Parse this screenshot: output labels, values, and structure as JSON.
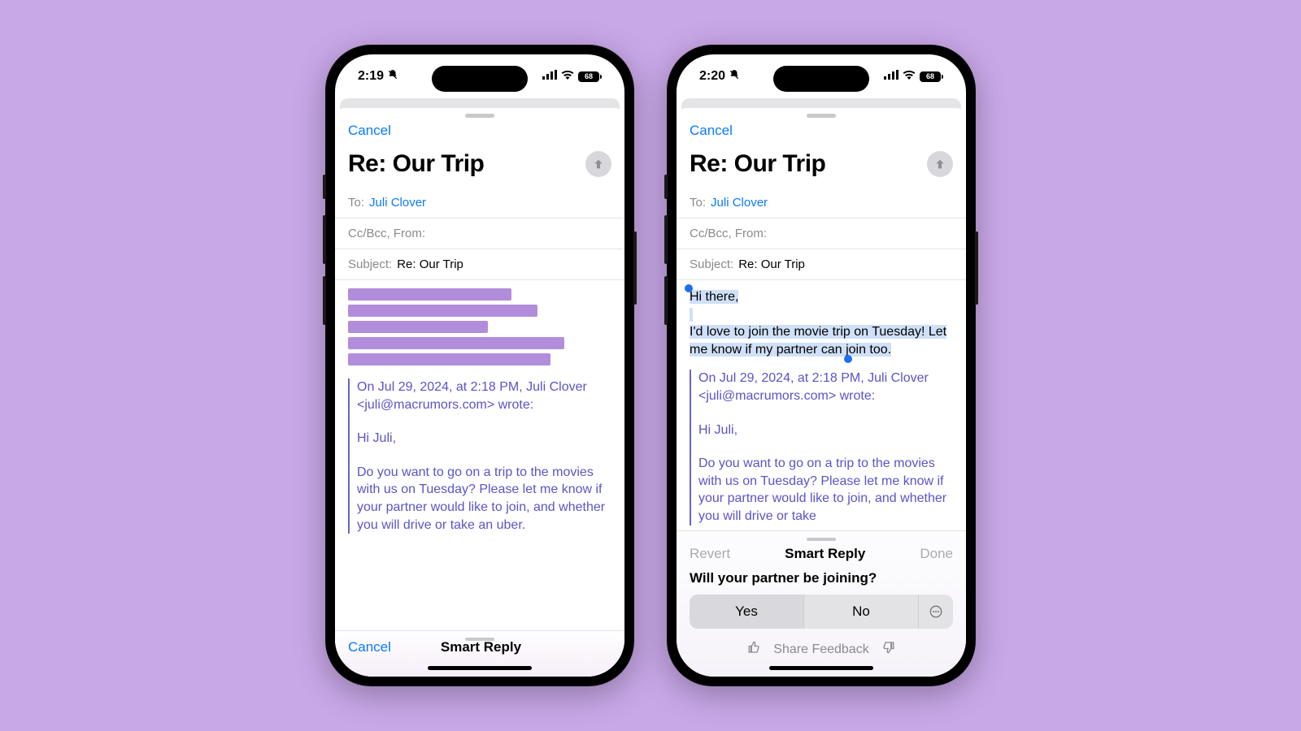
{
  "bg_color": "#c9a8e8",
  "phones": [
    {
      "status": {
        "time": "2:19",
        "battery": "68"
      },
      "sheet": {
        "cancel": "Cancel",
        "title": "Re: Our Trip",
        "to_label": "To:",
        "to_value": "Juli Clover",
        "ccbcc_label": "Cc/Bcc, From:",
        "subject_label": "Subject:",
        "subject_value": "Re: Our Trip",
        "shimmer_widths": [
          "62%",
          "72%",
          "53%",
          "82%",
          "77%"
        ],
        "quote_header": "On Jul 29, 2024, at 2:18 PM, Juli Clover <juli@macrumors.com> wrote:",
        "quote_greeting": "Hi Juli,",
        "quote_body": "Do you want to go on a trip to the movies with us on Tuesday? Please let me know if your partner would like to join, and whether you will drive or take an uber."
      },
      "bottom": {
        "cancel": "Cancel",
        "title": "Smart Reply"
      }
    },
    {
      "status": {
        "time": "2:20",
        "battery": "68"
      },
      "sheet": {
        "cancel": "Cancel",
        "title": "Re: Our Trip",
        "to_label": "To:",
        "to_value": "Juli Clover",
        "ccbcc_label": "Cc/Bcc, From:",
        "subject_label": "Subject:",
        "subject_value": "Re: Our Trip",
        "draft_line1": "Hi there,",
        "draft_line2": "I'd love to join the movie trip on Tuesday! Let me know if my partner can join too.",
        "quote_header": "On Jul 29, 2024, at 2:18 PM, Juli Clover <juli@macrumors.com> wrote:",
        "quote_greeting": "Hi Juli,",
        "quote_body": "Do you want to go on a trip to the movies with us on Tuesday? Please let me know if your partner would like to join, and whether you will drive or take"
      },
      "bottom": {
        "revert": "Revert",
        "title": "Smart Reply",
        "done": "Done",
        "question": "Will your partner be joining?",
        "yes": "Yes",
        "no": "No",
        "share_feedback": "Share Feedback"
      }
    }
  ]
}
